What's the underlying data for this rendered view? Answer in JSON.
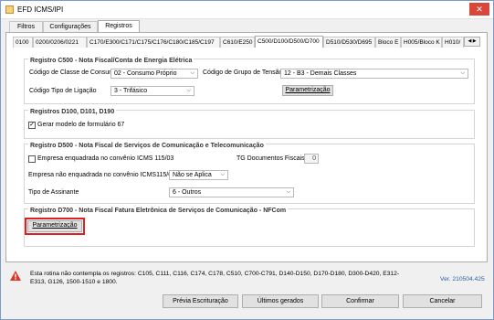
{
  "window": {
    "title": "EFD ICMS/IPI",
    "close_glyph": "✕"
  },
  "top_tabs": [
    {
      "label": "Filtros",
      "active": false
    },
    {
      "label": "Configurações",
      "active": false
    },
    {
      "label": "Registros",
      "active": true
    }
  ],
  "sub_tabs": [
    {
      "label": "0100",
      "active": false
    },
    {
      "label": "0200/0206/0221",
      "active": false
    },
    {
      "label": "C170/E300/C171/C175/C176/C180/C185/C197",
      "active": false
    },
    {
      "label": "C610/E250",
      "active": false
    },
    {
      "label": "C500/D100/D500/D700",
      "active": true
    },
    {
      "label": "D510/D530/D695",
      "active": false
    },
    {
      "label": "Bloco E",
      "active": false
    },
    {
      "label": "H005/Bloco K",
      "active": false
    },
    {
      "label": "H010/",
      "active": false
    }
  ],
  "scroll_arrows": "◀ ▶",
  "c500": {
    "title": "Registro C500 - Nota Fiscal/Conta de Energia Elétrica",
    "classe_label": "Código de Classe de Consumo",
    "classe_value": "02 - Consumo Próprio",
    "grupo_label": "Código de Grupo de Tensão",
    "grupo_value": "12 - B3 - Demais Classes",
    "ligacao_label": "Código Tipo de Ligação",
    "ligacao_value": "3 - Trifásico",
    "param_label": "Parametrização"
  },
  "d100": {
    "title": "Registros D100, D101, D190",
    "check_label": "Gerar modelo de formulário 67",
    "checked": true
  },
  "d500": {
    "title": "Registro D500 - Nota Fiscal de Serviços de Comunicação e Telecomunicação",
    "check_label": "Empresa enquadrada no convênio ICMS 115/03",
    "checked": false,
    "tg_label": "TG Documentos Fiscais",
    "tg_value": "0",
    "nao_enq_label": "Empresa não enquadrada no convênio ICMS115/03",
    "nao_enq_value": "Não se Aplica",
    "assinante_label": "Tipo de Assinante",
    "assinante_value": "6 - Outros"
  },
  "d700": {
    "title": "Registro D700 - Nota Fiscal Fatura Eletrônica de Serviços de Comunicação - NFCom",
    "param_label": "Parametrização"
  },
  "status": {
    "message": "Esta rotina não contempla os registros: C105, C111, C116, C174, C178, C510, C700-C791, D140-D150, D170-D180, D300-D420, E312-E313, G126, 1500-1510 e 1800.",
    "version": "Ver. 210504.425"
  },
  "footer": {
    "preview": "Prévia Escrituração",
    "ultimos": "Últimos gerados",
    "confirmar": "Confirmar",
    "cancelar": "Cancelar"
  },
  "dropdown_glyph": "⌵",
  "check_glyph": "✓",
  "colors": {
    "highlight": "#e02020",
    "version": "#2b60a8",
    "close": "#d9473b"
  }
}
